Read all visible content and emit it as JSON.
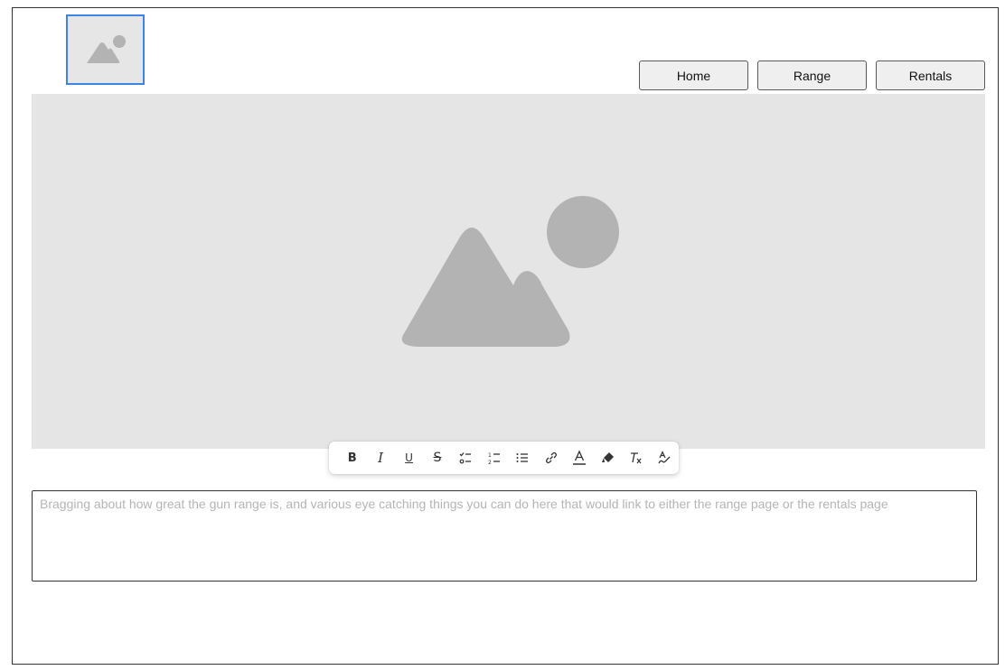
{
  "nav": {
    "home_label": "Home",
    "range_label": "Range",
    "rentals_label": "Rentals"
  },
  "logo": {
    "icon": "image-placeholder-icon"
  },
  "hero": {
    "icon": "image-placeholder-icon",
    "background": "#e5e5e5"
  },
  "toolbar": {
    "items": [
      {
        "name": "bold",
        "glyph": "B"
      },
      {
        "name": "italic",
        "glyph": "I"
      },
      {
        "name": "underline",
        "glyph": "U"
      },
      {
        "name": "strikethrough",
        "glyph": "S"
      },
      {
        "name": "checklist",
        "glyph": ""
      },
      {
        "name": "numbered-list",
        "glyph": ""
      },
      {
        "name": "bulleted-list",
        "glyph": ""
      },
      {
        "name": "link",
        "glyph": ""
      },
      {
        "name": "text-color",
        "glyph": "A"
      },
      {
        "name": "highlight",
        "glyph": ""
      },
      {
        "name": "clear-formatting",
        "glyph": "Tx"
      },
      {
        "name": "spellcheck",
        "glyph": "A"
      }
    ]
  },
  "content": {
    "placeholder": "Bragging about how great the gun range is, and various eye catching things you can do here that would link to either the range page or the rentals page"
  },
  "colors": {
    "accent": "#3a86e0",
    "placeholder_fill": "#e5e5e5",
    "placeholder_shape": "#b3b3b3"
  }
}
